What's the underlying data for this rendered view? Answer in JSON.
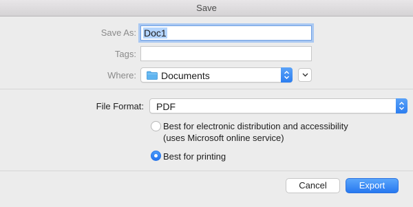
{
  "window": {
    "title": "Save"
  },
  "form": {
    "save_as_label": "Save As:",
    "save_as_value": "Doc1",
    "tags_label": "Tags:",
    "tags_value": "",
    "where_label": "Where:",
    "where_value": "Documents",
    "file_format_label": "File Format:",
    "file_format_value": "PDF"
  },
  "options": [
    {
      "line1": "Best for electronic distribution and accessibility",
      "line2": "(uses Microsoft online service)",
      "selected": false
    },
    {
      "line1": "Best for printing",
      "selected": true
    }
  ],
  "buttons": {
    "cancel": "Cancel",
    "export": "Export"
  },
  "icons": {
    "folder": "folder-icon",
    "stepper": "updown-chevron-icon",
    "expand": "chevron-down-icon"
  },
  "colors": {
    "accent": "#2c7ef0",
    "folder": "#5fb4f0"
  }
}
